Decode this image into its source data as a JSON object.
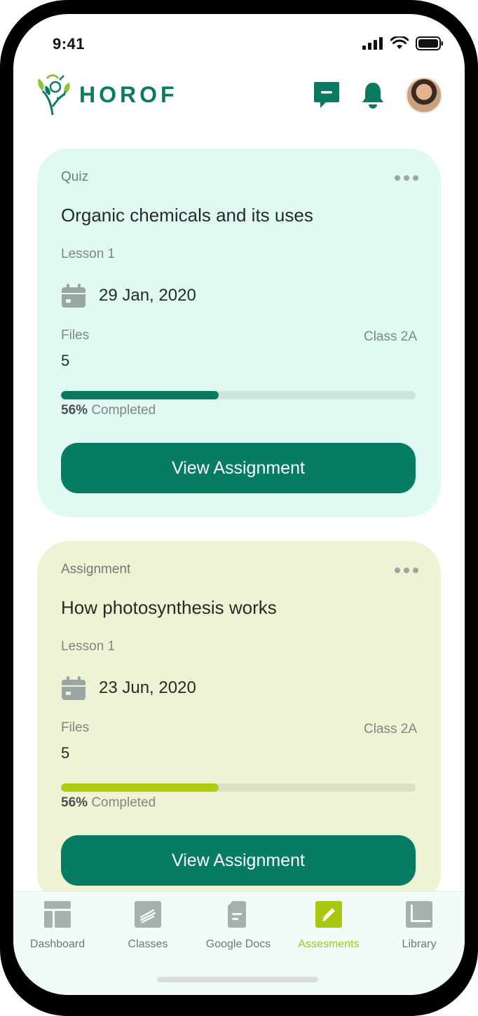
{
  "status_bar": {
    "time": "9:41"
  },
  "header": {
    "logo_text": "HOROF"
  },
  "cards": [
    {
      "type": "Quiz",
      "title": "Organic chemicals and its uses",
      "lesson": "Lesson 1",
      "date": "29 Jan, 2020",
      "files_label": "Files",
      "files_value": "5",
      "class_label": "Class 2A",
      "progress_fraction": 0.445,
      "progress_percent": "56%",
      "progress_suffix": "Completed",
      "button_label": "View Assignment"
    },
    {
      "type": "Assignment",
      "title": "How photosynthesis works",
      "lesson": "Lesson 1",
      "date": "23 Jun, 2020",
      "files_label": "Files",
      "files_value": "5",
      "class_label": "Class 2A",
      "progress_fraction": 0.445,
      "progress_percent": "56%",
      "progress_suffix": "Completed",
      "button_label": "View Assignment"
    }
  ],
  "bottom_nav": {
    "items": [
      {
        "label": "Dashboard",
        "icon": "dashboard-icon",
        "active": false
      },
      {
        "label": "Classes",
        "icon": "classes-icon",
        "active": false
      },
      {
        "label": "Google Docs",
        "icon": "google-docs-icon",
        "active": false
      },
      {
        "label": "Assesments",
        "icon": "assessments-icon",
        "active": true
      },
      {
        "label": "Library",
        "icon": "library-icon",
        "active": false
      }
    ]
  },
  "colors": {
    "brand": "#0a7b63",
    "quiz_card_bg": "#e0faf3",
    "assignment_card_bg": "#eef4d3",
    "assignment_accent": "#b1cc10",
    "nav_icon_inactive": "#a7b0ad",
    "nav_active": "#a8c70f"
  }
}
